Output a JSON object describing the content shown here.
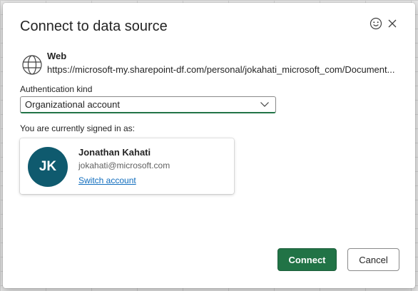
{
  "dialog": {
    "title": "Connect to data source",
    "feedback_icon": "smiley-icon",
    "close_icon": "close-icon"
  },
  "source": {
    "icon": "globe-icon",
    "type": "Web",
    "url": "https://microsoft-my.sharepoint-df.com/personal/jokahati_microsoft_com/Document..."
  },
  "auth": {
    "label": "Authentication kind",
    "selected": "Organizational account"
  },
  "signed_in": {
    "label": "You are currently signed in as:",
    "initials": "JK",
    "name": "Jonathan Kahati",
    "email": "jokahati@microsoft.com",
    "switch_label": "Switch account"
  },
  "buttons": {
    "connect": "Connect",
    "cancel": "Cancel"
  },
  "colors": {
    "accent": "#217346",
    "avatar": "#0f5a6e",
    "link": "#0f6cbd"
  }
}
